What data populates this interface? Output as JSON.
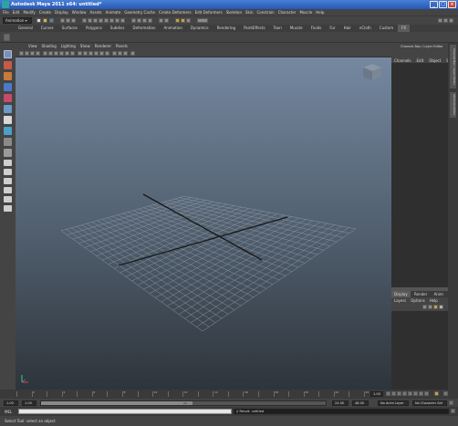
{
  "window": {
    "title": "Autodesk Maya 2011 x64: untitled*"
  },
  "menubar": [
    "File",
    "Edit",
    "Modify",
    "Create",
    "Display",
    "Window",
    "Assets",
    "Animate",
    "Geometry Cache",
    "Create Deformers",
    "Edit Deformers",
    "Skeleton",
    "Skin",
    "Constrain",
    "Character",
    "Muscle",
    "Help"
  ],
  "statusline": {
    "mode": "Animation"
  },
  "shelf": {
    "tabs": [
      "General",
      "Curves",
      "Surfaces",
      "Polygons",
      "Subdivs",
      "Deformation",
      "Animation",
      "Dynamics",
      "Rendering",
      "PaintEffects",
      "Toon",
      "Muscle",
      "Fluids",
      "Fur",
      "Hair",
      "nCloth",
      "Custom",
      "FX"
    ],
    "active": "FX"
  },
  "panel": {
    "menu": [
      "View",
      "Shading",
      "Lighting",
      "Show",
      "Renderer",
      "Panels"
    ]
  },
  "channelbox": {
    "header": "Channel Box / Layer Editor",
    "menu": [
      "Channels",
      "Edit",
      "Object",
      "Show"
    ]
  },
  "vertical_tabs": [
    "Channel Box / Layer Editor",
    "Attribute Editor"
  ],
  "layers": {
    "tabs": [
      "Display",
      "Render",
      "Anim"
    ],
    "active": "Display",
    "menu": [
      "Layers",
      "Options",
      "Help"
    ]
  },
  "timeslider": {
    "tick_labels": [
      "2",
      "4",
      "6",
      "8",
      "10",
      "12",
      "14",
      "16",
      "18",
      "20",
      "22",
      "24"
    ],
    "current_frame": "1.00"
  },
  "rangeslider": {
    "start": "1.00",
    "inner_start": "1.00",
    "range_label": "24",
    "inner_end": "24.00",
    "end": "48.00",
    "anim_layer": "No Anim Layer",
    "character_set": "No Character Set"
  },
  "cmdline": {
    "label": "MEL",
    "output": "// Result: untitled"
  },
  "helpline": {
    "text": "Select Tool: select an object"
  },
  "colors": {
    "accent": "#2358b8",
    "viewport_top": "#7588a0",
    "viewport_bottom": "#2e343b",
    "grid": "#8a94a0"
  }
}
